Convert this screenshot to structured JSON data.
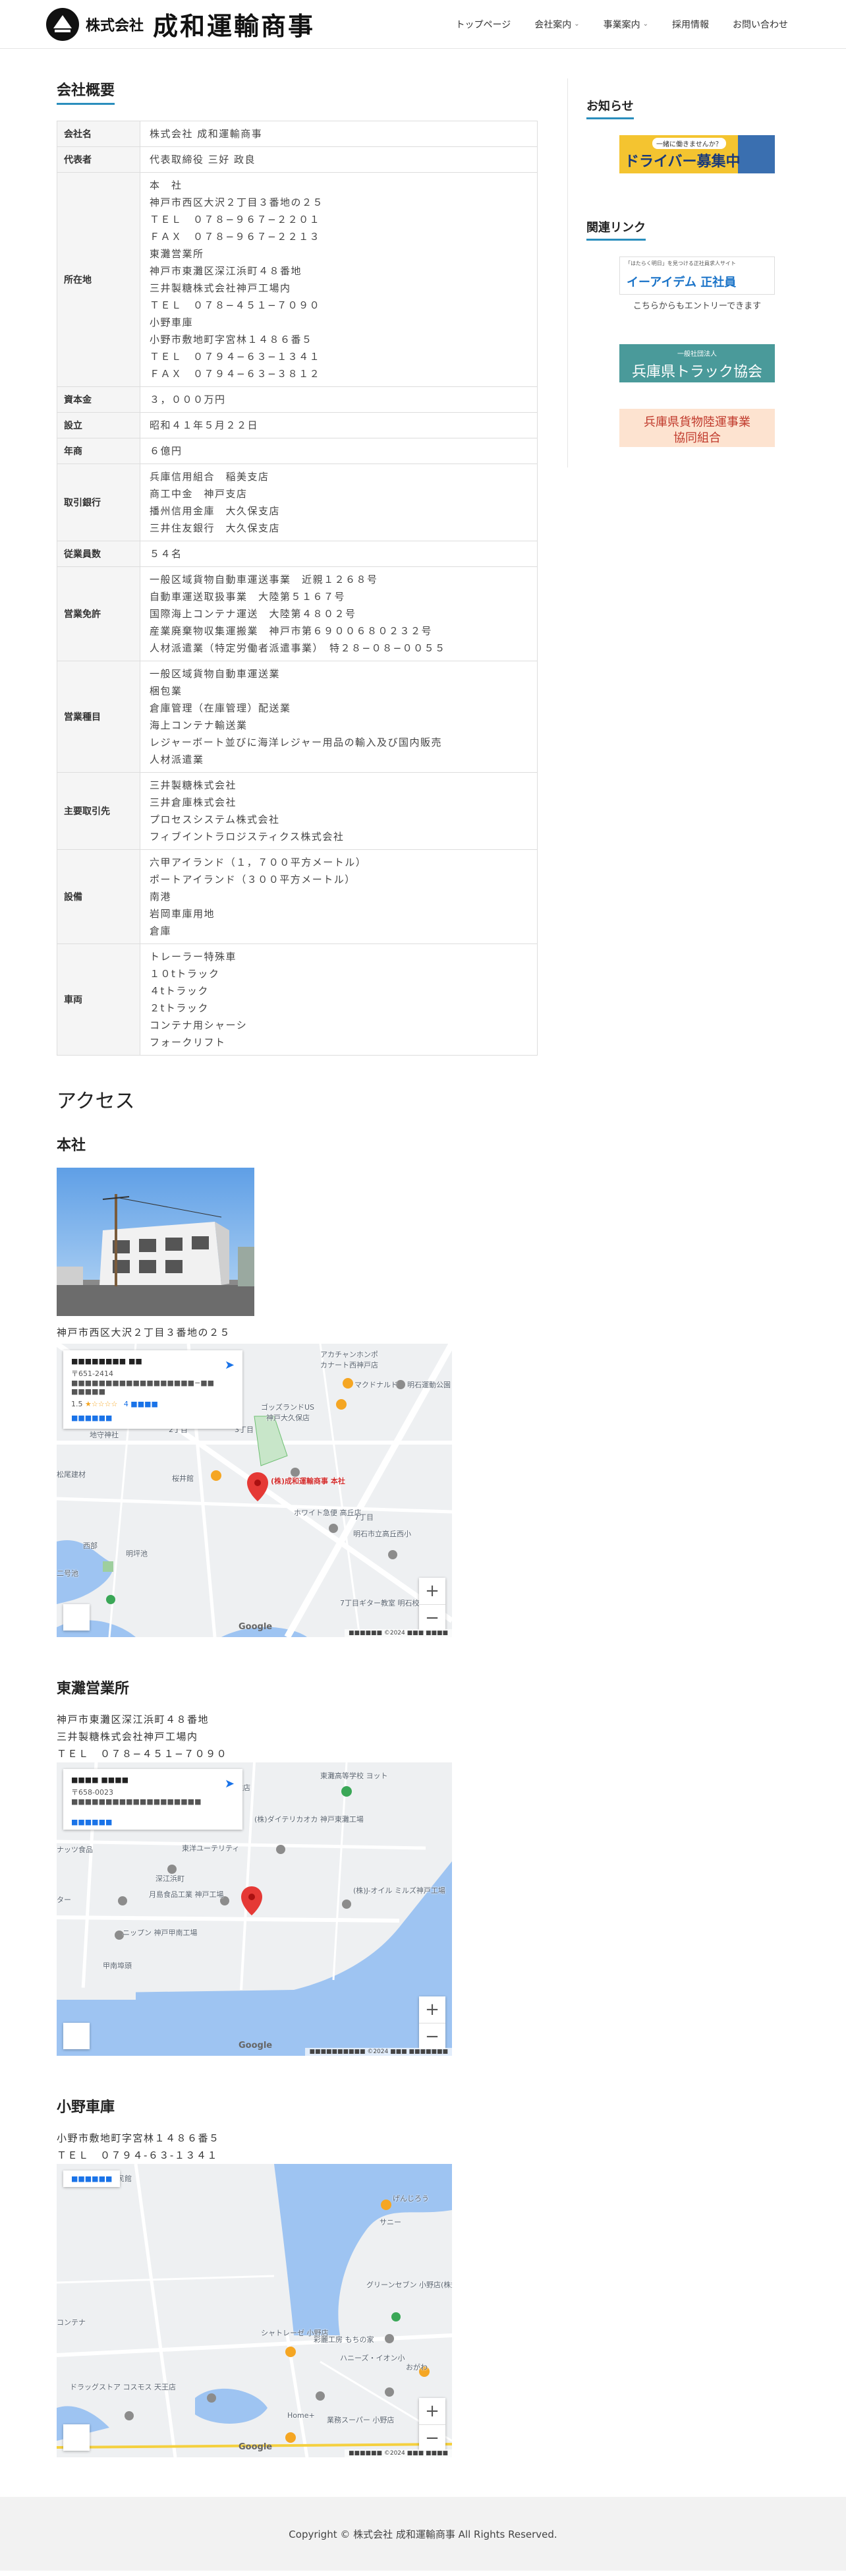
{
  "header": {
    "logo_prefix": "株式会社",
    "logo_name": "成和運輸商事",
    "nav": [
      {
        "label": "トップページ",
        "has_dropdown": false
      },
      {
        "label": "会社案内",
        "has_dropdown": true
      },
      {
        "label": "事業案内",
        "has_dropdown": true
      },
      {
        "label": "採用情報",
        "has_dropdown": false
      },
      {
        "label": "お問い合わせ",
        "has_dropdown": false
      }
    ]
  },
  "profile": {
    "title": "会社概要",
    "rows": [
      {
        "label": "会社名",
        "lines": [
          "株式会社 成和運輸商事"
        ]
      },
      {
        "label": "代表者",
        "lines": [
          "代表取締役 三好 政良"
        ]
      },
      {
        "label": "所在地",
        "lines": [
          "本　社",
          "神戸市西区大沢２丁目３番地の２５",
          "ＴＥＬ　０７８−９６７−２２０１",
          "ＦＡＸ　０７８−９６７−２２１３",
          "東灘営業所",
          "神戸市東灘区深江浜町４８番地",
          "三井製糖株式会社神戸工場内",
          "ＴＥＬ　０７８−４５１−７０９０",
          "小野車庫",
          "小野市敷地町字宮林１４８６番５",
          "ＴＥＬ　０７９４−６３−１３４１",
          "ＦＡＸ　０７９４−６３−３８１２"
        ]
      },
      {
        "label": "資本金",
        "lines": [
          "３，０００万円"
        ]
      },
      {
        "label": "設立",
        "lines": [
          "昭和４１年５月２２日"
        ]
      },
      {
        "label": "年商",
        "lines": [
          "６億円"
        ]
      },
      {
        "label": "取引銀行",
        "lines": [
          "兵庫信用組合　稲美支店",
          "商工中金　神戸支店",
          "播州信用金庫　大久保支店",
          "三井住友銀行　大久保支店"
        ]
      },
      {
        "label": "従業員数",
        "lines": [
          "５４名"
        ]
      },
      {
        "label": "営業免許",
        "lines": [
          "一般区域貨物自動車運送事業　近親１２６８号",
          "自動車運送取扱事業　大陸第５１６７号",
          "国際海上コンテナ運送　大陸第４８０２号",
          "産業廃棄物収集運搬業　神戸市第６９００６８０２３２号",
          "人材派遣業（特定労働者派遣事業）　特２８−０８−００５５"
        ]
      },
      {
        "label": "営業種目",
        "lines": [
          "一般区域貨物自動車運送業",
          "梱包業",
          "倉庫管理（在庫管理）配送業",
          "海上コンテナ輸送業",
          "レジャーボート並びに海洋レジャー用品の輸入及び国内販売",
          "人材派遣業"
        ]
      },
      {
        "label": "主要取引先",
        "lines": [
          "三井製糖株式会社",
          "三井倉庫株式会社",
          "プロセスシステム株式会社",
          "フィブイントラロジスティクス株式会社"
        ]
      },
      {
        "label": "設備",
        "lines": [
          "六甲アイランド（１，７００平方メートル）",
          "ポートアイランド（３００平方メートル）",
          "南港",
          "岩岡車庫用地",
          "倉庫"
        ]
      },
      {
        "label": "車両",
        "lines": [
          "トレーラー特殊車",
          "１０tトラック",
          "４tトラック",
          "２tトラック",
          "コンテナ用シャーシ",
          "フォークリフト"
        ]
      }
    ]
  },
  "access": {
    "title": "アクセス",
    "honsha": {
      "title": "本社",
      "address": "神戸市西区大沢２丁目３番地の２５",
      "map": {
        "info_title": "■■■■■■■■ ■■",
        "info_addr": "〒651-2414 ■■■■■■■■■■■■■■■■■■−■■ ■■■■■",
        "rating": "1.5",
        "stars": "★☆☆☆☆",
        "reviews": "4 ■■■■",
        "link": "■■■■■■",
        "labels": [
          "アカチャンホンポ",
          "カナート西神戸店",
          "マクドナルド",
          "明石運動公園",
          "ゴッズランドUS",
          "神戸大久保店",
          "2丁目",
          "3丁目",
          "地守神社",
          "桜井館",
          "(株)成和運輸商事 本社",
          "ホワイト急便 高丘店",
          "明石市立高丘西小",
          "7丁目",
          "明坪池",
          "7丁目ギター教室 明石校",
          "二号池",
          "西部",
          "松尾建材"
        ],
        "google": "Google",
        "footer": "■■■■■■ ©2024 ■■■ ■■■■"
      }
    },
    "higashinada": {
      "title": "東灘営業所",
      "lines": [
        "神戸市東灘区深江浜町４８番地",
        "三井製糖株式会社神戸工場内",
        "ＴＥＬ　０７８−４５１−７０９０"
      ],
      "map": {
        "info_title": "■■■■ ■■■■",
        "info_addr": "〒658-0023 ■■■■■■■■■■■■■■■■■■■",
        "link": "■■■■■■",
        "labels": [
          "東灘高等学校 ヨット",
          "江東灘店",
          "(株)ダイテリカオカ 神戸東灘工場",
          "ナッツ食品",
          "東洋ユーテリティ",
          "深江浜町",
          "月島食品工業 神戸工場",
          "(株)J-オイル ミルズ神戸工場",
          "ニップン 神戸甲南工場",
          "甲南埠頭",
          "ター"
        ],
        "google": "Google",
        "footer": "■■■■■■■■■■ ©2024 ■■■ ■■■■■■■"
      }
    },
    "ono": {
      "title": "小野車庫",
      "lines": [
        "小野市敷地町字宮林１４８６番５",
        "ＴＥＬ　０７９４-６３-１３４１"
      ],
      "map": {
        "link": "■■■■■■",
        "labels": [
          "町公民館",
          "げんじろう",
          "サニー",
          "グリーンセブン 小野店(株式会社",
          "シャトレーゼ 小野店",
          "彩麗工房 もちの家",
          "ハニーズ・イオン小",
          "おがわ",
          "ドラッグストア コスモス 天王店",
          "業務スーパー 小野店",
          "Home+",
          "コンテナ"
        ],
        "google": "Google",
        "footer": "■■■■■■ ©2024 ■■■ ■■■■"
      }
    }
  },
  "sidebar": {
    "news_title": "お知らせ",
    "links_title": "関連リンク",
    "banner1": {
      "top": "一緒に働きませんか？",
      "main": "ドライバー募集中"
    },
    "banner2": {
      "top": "「はたらく明日」を見つける正社員求人サイト",
      "main": "イーアイデム 正社員"
    },
    "banner2_caption": "こちらからもエントリーできます",
    "banner3": {
      "top": "一般社団法人",
      "main": "兵庫県トラック協会"
    },
    "banner4": {
      "line1": "兵庫県貨物陸運事業",
      "line2": "協同組合"
    }
  },
  "footer": {
    "copyright": "Copyright © 株式会社 成和運輸商事 All Rights Reserved."
  },
  "colors": {
    "accent": "#2a8ebd",
    "map_water": "#9ec4f2",
    "map_land": "#eceff1"
  }
}
